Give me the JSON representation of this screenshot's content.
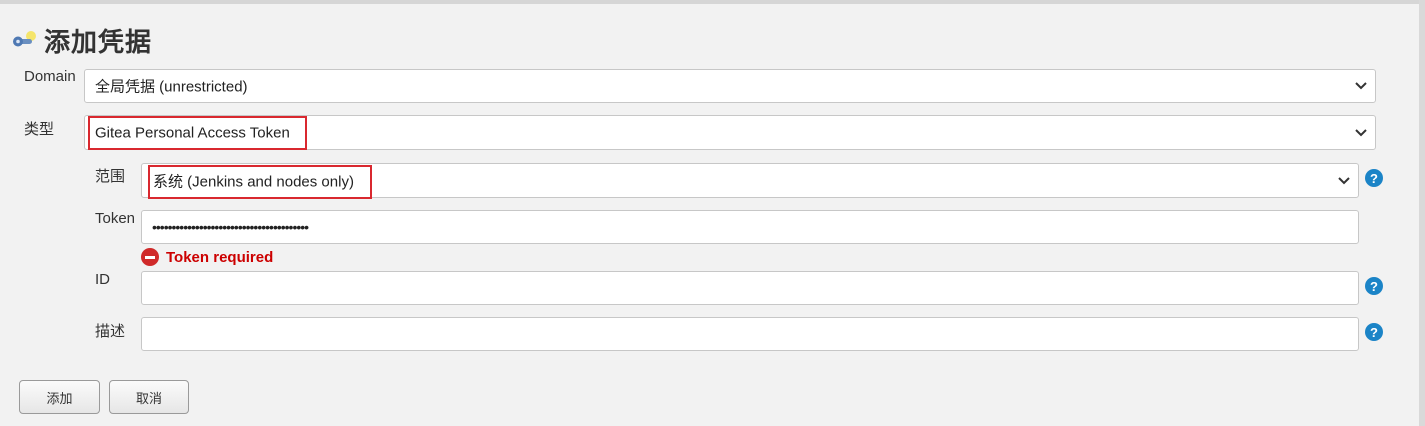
{
  "page": {
    "title": "添加凭据",
    "title_icon": "key-icon"
  },
  "form": {
    "domain": {
      "label": "Domain",
      "value": "全局凭据 (unrestricted)"
    },
    "kind": {
      "label": "类型",
      "value": "Gitea Personal Access Token"
    },
    "scope": {
      "label": "范围",
      "value": "系统 (Jenkins and nodes only)"
    },
    "token": {
      "label": "Token",
      "masked_value": "••••••••••••••••••••••••••••••••••••••••",
      "error": "Token required"
    },
    "id": {
      "label": "ID",
      "value": ""
    },
    "description": {
      "label": "描述",
      "value": ""
    }
  },
  "buttons": {
    "add": "添加",
    "cancel": "取消"
  },
  "colors": {
    "highlight": "#d9282f",
    "error": "#cc0000",
    "help": "#1b84c7"
  }
}
